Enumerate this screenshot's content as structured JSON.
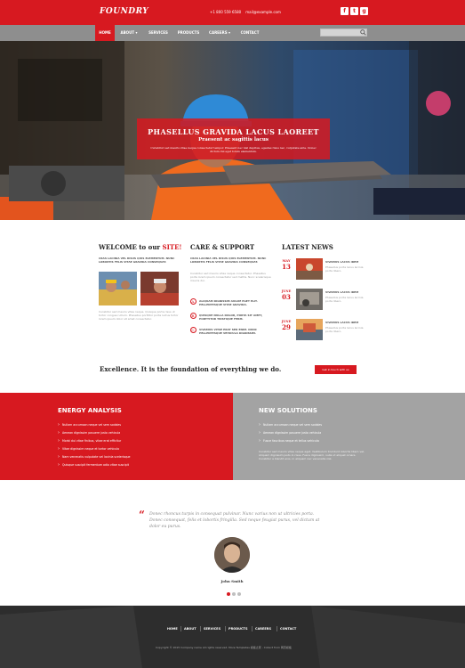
{
  "header": {
    "logo": "FOUNDRY",
    "phone": "+1 800 559 6580",
    "email": "mail@example.com",
    "social": [
      {
        "icon": "facebook-icon",
        "glyph": "f"
      },
      {
        "icon": "twitter-icon",
        "glyph": "t"
      },
      {
        "icon": "google-plus-icon",
        "glyph": "g"
      }
    ]
  },
  "nav": {
    "items": [
      {
        "label": "HOME",
        "active": true
      },
      {
        "label": "ABOUT ▾"
      },
      {
        "label": "SERVICES"
      },
      {
        "label": "PRODUCTS"
      },
      {
        "label": "CAREERS ▾"
      },
      {
        "label": "CONTACT"
      }
    ],
    "search_placeholder": ""
  },
  "hero": {
    "title": "PHASELLUS GRAVIDA LACUS LAOREET",
    "subtitle": "Praesent ac sagittis lacus",
    "text": "Curabitur sed mauris vitae neque consectetur tempor. Praesent nec nisl dapibus, egestas risus nec, vulputate ante. Donec dictum dui eget lorem elementum."
  },
  "welcome": {
    "title_prefix": "WELCOME to our",
    "title_accent": "SITE!",
    "caption": "CRAS LACINIA VEL RISUS QUIS ELEMENTUM. NUNC LOBORTIS FELIS VITAE GRAVIDA CONSEQUAT.",
    "text": "Curabitur sed mauris vitae neque. Quisque porta risus ut tortor congue rutrum. Phasellus porttitor porta luctus tortor lorem ipsum dolor sit amet consectetur."
  },
  "care": {
    "title": "CARE & SUPPORT",
    "caption": "CRAS LACINIA VEL RISUS QUIS ELEMENTUM. NUNC LOBORTIS FELIS VITAE GRAVIDA CONSEQUAT.",
    "text": "Curabitur sed mauris vitae neque consectetur. Phasellus porta lorem ipsum consectetur sed mattis. Nunc scelerisque mauris dui.",
    "items": [
      {
        "num": "A.",
        "text": "ALIQUAM DIGNISSIM AUGUE EGET ELIT. PELLENTESQUE VITAE GRAVIDA."
      },
      {
        "num": "B.",
        "text": "QUISQUE NULLA DOLOR, PORTA SIT AMET, PORTTITOR TRISTIQUE FERM."
      },
      {
        "num": "C.",
        "text": "VIVAMUS VITAE ERAT SED ENIM. NUNC PELLENTESQUE VEHICULA DIGNISSIM."
      }
    ]
  },
  "news": {
    "title": "LATEST NEWS",
    "items": [
      {
        "month": "MAY",
        "day": "13",
        "title": "VIVAMUS LACUS IDEM",
        "text": "Phasellus porta lacus lacinia porta libero."
      },
      {
        "month": "JUNE",
        "day": "03",
        "title": "VIVAMUS LACUS IDEM",
        "text": "Phasellus porta lacus lacinia porta libero."
      },
      {
        "month": "JUNE",
        "day": "29",
        "title": "VIVAMUS LACUS IDEM",
        "text": "Phasellus porta lacus lacinia porta libero."
      }
    ]
  },
  "banner": {
    "text": "Excellence. It is the foundation of everything we do.",
    "button": "Get in touch with us"
  },
  "energy": {
    "title": "ENERGY ANALYSIS",
    "items": [
      "Nullam accumsan neque vel sem sodales",
      "Aenean dignissim posuere justo vehicula",
      "Morbi dui vitae finibus, vitae erat efficitur",
      "Vitae dignissim neque et tortor vehicula",
      "Nam venenatis vulputate vel lacinia scelerisque",
      "Quisque suscipit fermentum odio vitae suscipit"
    ]
  },
  "solutions": {
    "title": "NEW SOLUTIONS",
    "items": [
      "Nullam accumsan neque vel sem sodales",
      "Aenean dignissim posuere justo vehicula",
      "Fusce faucibus neque et tellus vehicula"
    ],
    "text": "Curabitur sed mauris vitae neque eget. Vestibulum tincidunt lobortis libero vel. Aliquam dignissim justo in risus. Fusce dignissim, nulla ut aliquet ornare. Curabitur a blandit eros, in aliquam nec venenatis nisl."
  },
  "testimonial": {
    "quote": "Donec rhoncus turpis in consequat pulvinar. Nunc varius non ut ultricies porta. Donec consequat, felis et lobortis fringilla. Sed neque feugiat purus, vel dictum at dolor eu purus.",
    "author": "John Smith"
  },
  "footer": {
    "nav": [
      "HOME",
      "ABOUT",
      "SERVICES",
      "PRODUCTS",
      "CAREERS",
      "CONTACT"
    ],
    "copyright": "Copyright © 2015 Company name All rights reserved. More Templates 模板之家 - Collect from 网页模板"
  },
  "colors": {
    "accent": "#d71920",
    "nav": "#8e8e8e",
    "grey_panel": "#a3a3a3",
    "footer": "#333333"
  }
}
